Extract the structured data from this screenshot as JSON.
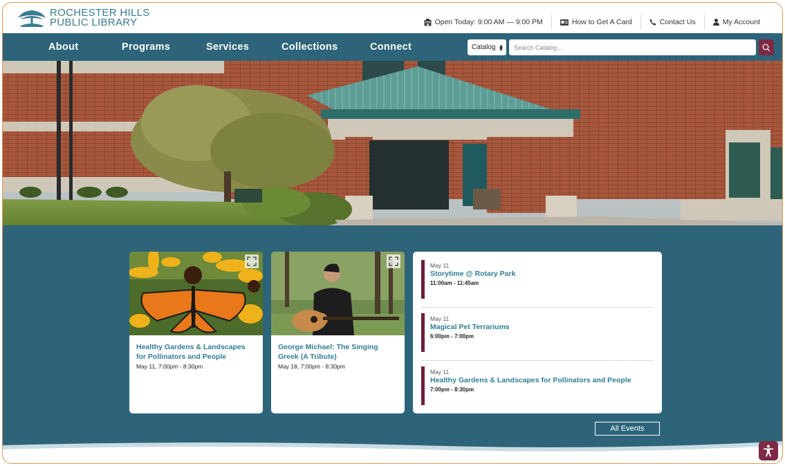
{
  "brand": {
    "line1": "ROCHESTER HILLS",
    "line2": "PUBLIC LIBRARY",
    "color": "#3a7c91"
  },
  "utility": {
    "hours": "Open Today: 9:00 AM — 9:00 PM",
    "card": "How to Get A Card",
    "contact": "Contact Us",
    "account": "My Account"
  },
  "nav": {
    "items": [
      "About",
      "Programs",
      "Services",
      "Collections",
      "Connect"
    ]
  },
  "search": {
    "scope": "Catalog",
    "placeholder": "Search Catalog..."
  },
  "colors": {
    "nav": "#2d6479",
    "accent": "#7d2a45",
    "link": "#2f7e93"
  },
  "featured": [
    {
      "title": "Healthy Gardens & Landscapes for Pollinators and People",
      "date": "May 11, 7:00pm - 8:30pm",
      "image": "monarch-butterfly-on-black-eyed-susans"
    },
    {
      "title": "George Michael: The Singing Greek (A Tribute)",
      "date": "May 18, 7:00pm - 8:30pm",
      "image": "guitarist-in-leather-jacket"
    }
  ],
  "upcoming": [
    {
      "date": "May 11",
      "title": "Storytime @ Rotary Park",
      "time": "11:00am - 11:45am"
    },
    {
      "date": "May 11",
      "title": "Magical Pet Terrariums",
      "time": "6:00pm - 7:00pm"
    },
    {
      "date": "May 11",
      "title": "Healthy Gardens & Landscapes for Pollinators and People",
      "time": "7:00pm - 8:30pm"
    }
  ],
  "all_events_label": "All Events"
}
